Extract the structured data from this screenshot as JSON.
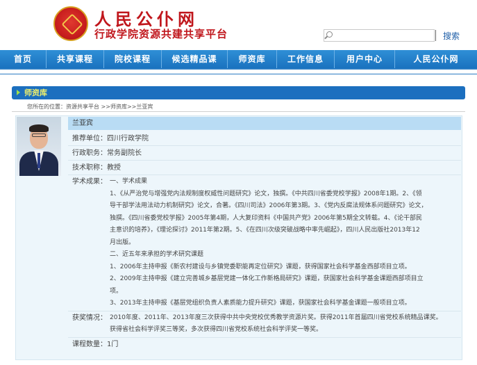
{
  "site": {
    "title": "人民公仆网",
    "subtitle": "行政学院资源共建共享平台"
  },
  "search": {
    "placeholder": "",
    "button_label": "搜索"
  },
  "nav": {
    "items": [
      "首页",
      "共享课程",
      "院校课程",
      "候选精品课",
      "师资库",
      "工作信息",
      "用户中心",
      "人民公仆网"
    ]
  },
  "section": {
    "title": "师资库"
  },
  "breadcrumb": "您所在的位置：资源共享平台 >>师资库>>兰亚宾",
  "teacher": {
    "name": "兰亚宾",
    "unit": "推荐单位：四川行政学院",
    "position": "行政职务：常务副院长",
    "title": "技术职称：教授",
    "achievements_label": "学术成果：",
    "achievements_lines": [
      "一、学术成果",
      "1、《从严治党与增强党内法规制度权威性问题研究》论文，独撰。《中共四川省委党校学报》2008年1期。2、《领",
      "导干部学法用法动力机制研究》论文，合著。《四川司法》2006年第3期。3、《党内反腐法规体系问题研究》论文，",
      "独撰。《四川省委党校学报》2005年第4期，人大复印资料《中国共产党》2006年第5期全文转载。4、《论干部民",
      "主意识的培养》，《理论探讨》2011年第2期。5、《在四川次级突破战略中率先崛起》，四川人民出版社2013年12",
      "月出版。",
      "二、近五年来承担的学术研究课题",
      "1、2006年主持申报《新农村建设与乡镇党委职能再定位研究》课题，获得国家社会科学基金西部项目立项。",
      "2、2009年主持申报《建立完善城乡基层党建一体化工作新格局研究》课题，获国家社会科学基金课题西部项目立",
      "项。",
      "3、2013年主持申报《基层党组织负责人素质能力提升研究》课题，获国家社会科学基金课题一般项目立项。"
    ],
    "awards_label": "获奖情况：",
    "awards_lines": [
      "2010年度、2011年、2013年度三次获得中共中央党校优秀教学资源片奖。获得2011年首届四川省党校系统精品课奖。",
      "获得省社会科学评奖三等奖，多次获得四川省党校系统社会科学评奖一等奖。"
    ],
    "courses": "课程数量：1门"
  },
  "colors": {
    "brand_red": "#c0161c",
    "nav_blue": "#1a72bf",
    "section_yellow": "#f2f06a",
    "card_bg": "#edf6fb"
  }
}
